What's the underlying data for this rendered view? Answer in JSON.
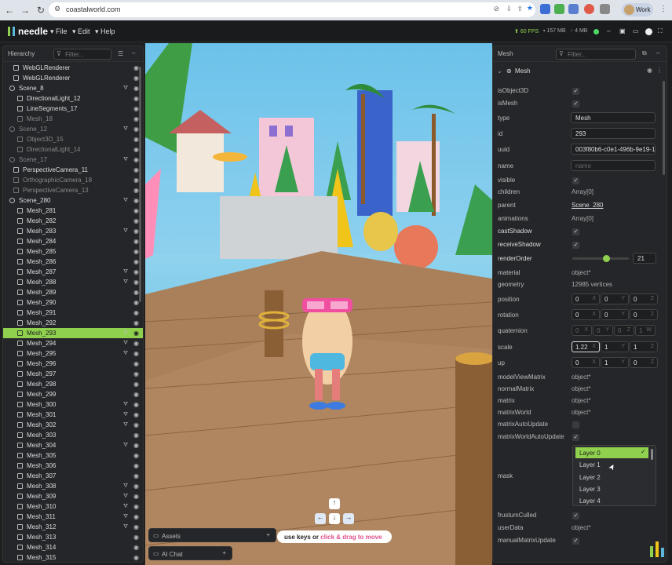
{
  "browser": {
    "url": "coastalworld.com",
    "profile": "Work"
  },
  "toolbar": {
    "logo": "needle",
    "menus": [
      "File",
      "Edit",
      "Help"
    ],
    "fps": "60 FPS",
    "memory": "157 MB",
    "gpu": "4 MB"
  },
  "hierarchy": {
    "title": "Hierarchy",
    "filter_placeholder": "Filter...",
    "items": [
      {
        "label": "WebGLRenderer",
        "dim": false,
        "indent": 1,
        "trigger": false
      },
      {
        "label": "WebGLRenderer",
        "dim": false,
        "indent": 1,
        "trigger": false
      },
      {
        "label": "Scene_8",
        "dim": false,
        "indent": 0,
        "trigger": true
      },
      {
        "label": "DirectionalLight_12",
        "dim": false,
        "indent": 2,
        "trigger": false
      },
      {
        "label": "LineSegments_17",
        "dim": false,
        "indent": 2,
        "trigger": false
      },
      {
        "label": "Mesh_18",
        "dim": true,
        "indent": 2,
        "trigger": false
      },
      {
        "label": "Scene_12",
        "dim": true,
        "indent": 0,
        "trigger": true
      },
      {
        "label": "Object3D_15",
        "dim": true,
        "indent": 2,
        "trigger": false
      },
      {
        "label": "DirectionalLight_14",
        "dim": true,
        "indent": 2,
        "trigger": false
      },
      {
        "label": "Scene_17",
        "dim": true,
        "indent": 0,
        "trigger": true
      },
      {
        "label": "PerspectiveCamera_11",
        "dim": false,
        "indent": 1,
        "trigger": false
      },
      {
        "label": "OrthographicCamera_18",
        "dim": true,
        "indent": 1,
        "trigger": false
      },
      {
        "label": "PerspectiveCamera_13",
        "dim": true,
        "indent": 1,
        "trigger": false
      },
      {
        "label": "Scene_280",
        "dim": false,
        "indent": 0,
        "trigger": true
      },
      {
        "label": "Mesh_281",
        "dim": false,
        "indent": 2,
        "trigger": false
      },
      {
        "label": "Mesh_282",
        "dim": false,
        "indent": 2,
        "trigger": false
      },
      {
        "label": "Mesh_283",
        "dim": false,
        "indent": 2,
        "trigger": true
      },
      {
        "label": "Mesh_284",
        "dim": false,
        "indent": 2,
        "trigger": false
      },
      {
        "label": "Mesh_285",
        "dim": false,
        "indent": 2,
        "trigger": false
      },
      {
        "label": "Mesh_286",
        "dim": false,
        "indent": 2,
        "trigger": false
      },
      {
        "label": "Mesh_287",
        "dim": false,
        "indent": 2,
        "trigger": true
      },
      {
        "label": "Mesh_288",
        "dim": false,
        "indent": 2,
        "trigger": true
      },
      {
        "label": "Mesh_289",
        "dim": false,
        "indent": 2,
        "trigger": false
      },
      {
        "label": "Mesh_290",
        "dim": false,
        "indent": 2,
        "trigger": false
      },
      {
        "label": "Mesh_291",
        "dim": false,
        "indent": 2,
        "trigger": false
      },
      {
        "label": "Mesh_292",
        "dim": false,
        "indent": 2,
        "trigger": false
      },
      {
        "label": "Mesh_293",
        "dim": false,
        "indent": 2,
        "trigger": true,
        "selected": true
      },
      {
        "label": "Mesh_294",
        "dim": false,
        "indent": 2,
        "trigger": true
      },
      {
        "label": "Mesh_295",
        "dim": false,
        "indent": 2,
        "trigger": true
      },
      {
        "label": "Mesh_296",
        "dim": false,
        "indent": 2,
        "trigger": false
      },
      {
        "label": "Mesh_297",
        "dim": false,
        "indent": 2,
        "trigger": false
      },
      {
        "label": "Mesh_298",
        "dim": false,
        "indent": 2,
        "trigger": false
      },
      {
        "label": "Mesh_299",
        "dim": false,
        "indent": 2,
        "trigger": false
      },
      {
        "label": "Mesh_300",
        "dim": false,
        "indent": 2,
        "trigger": true
      },
      {
        "label": "Mesh_301",
        "dim": false,
        "indent": 2,
        "trigger": true
      },
      {
        "label": "Mesh_302",
        "dim": false,
        "indent": 2,
        "trigger": true
      },
      {
        "label": "Mesh_303",
        "dim": false,
        "indent": 2,
        "trigger": false
      },
      {
        "label": "Mesh_304",
        "dim": false,
        "indent": 2,
        "trigger": true
      },
      {
        "label": "Mesh_305",
        "dim": false,
        "indent": 2,
        "trigger": false
      },
      {
        "label": "Mesh_306",
        "dim": false,
        "indent": 2,
        "trigger": false
      },
      {
        "label": "Mesh_307",
        "dim": false,
        "indent": 2,
        "trigger": false
      },
      {
        "label": "Mesh_308",
        "dim": false,
        "indent": 2,
        "trigger": true
      },
      {
        "label": "Mesh_309",
        "dim": false,
        "indent": 2,
        "trigger": true
      },
      {
        "label": "Mesh_310",
        "dim": false,
        "indent": 2,
        "trigger": true
      },
      {
        "label": "Mesh_311",
        "dim": false,
        "indent": 2,
        "trigger": true
      },
      {
        "label": "Mesh_312",
        "dim": false,
        "indent": 2,
        "trigger": true
      },
      {
        "label": "Mesh_313",
        "dim": false,
        "indent": 2,
        "trigger": false
      },
      {
        "label": "Mesh_314",
        "dim": false,
        "indent": 2,
        "trigger": false
      },
      {
        "label": "Mesh_315",
        "dim": false,
        "indent": 2,
        "trigger": false
      }
    ]
  },
  "viewport": {
    "hint_prefix": "use keys or",
    "hint_accent": "click & drag to move"
  },
  "bottom_panels": {
    "assets": "Assets",
    "ai_chat": "AI Chat"
  },
  "inspector": {
    "title": "Mesh",
    "filter_placeholder": "Filter...",
    "section": "Mesh",
    "props": {
      "isObject3D": "isObject3D",
      "isMesh": "isMesh",
      "type": "type",
      "type_val": "Mesh",
      "id": "id",
      "id_val": "293",
      "uuid": "uuid",
      "uuid_val": "003f80b6-c0e1-496b-9e19-1f",
      "name": "name",
      "name_placeholder": "name",
      "visible": "visible",
      "children": "children",
      "children_val": "Array[0]",
      "parent": "parent",
      "parent_val": "Scene_280",
      "animations": "animations",
      "animations_val": "Array[0]",
      "castShadow": "castShadow",
      "receiveShadow": "receiveShadow",
      "renderOrder": "renderOrder",
      "renderOrder_val": "21",
      "material": "material",
      "material_val": "object*",
      "geometry": "geometry",
      "geometry_val": "12985 vertices",
      "position": "position",
      "rotation": "rotation",
      "quaternion": "quaternion",
      "scale": "scale",
      "up": "up",
      "modelViewMatrix": "modelViewMatrix",
      "normalMatrix": "normalMatrix",
      "matrix": "matrix",
      "matrixWorld": "matrixWorld",
      "obj_val": "object*",
      "matrixAutoUpdate": "matrixAutoUpdate",
      "matrixWorldAutoUpdate": "matrixWorldAutoUpdate",
      "mask": "mask",
      "frustumCulled": "frustumCulled",
      "userData": "userData",
      "manualMatrixUpdate": "manualMatrixUpdate"
    },
    "vectors": {
      "position": [
        "0",
        "0",
        "0"
      ],
      "rotation": [
        "0",
        "0",
        "0"
      ],
      "quaternion": [
        "0",
        "0",
        "0",
        "1"
      ],
      "scale": [
        "1.22",
        "1",
        "1"
      ],
      "up": [
        "0",
        "1",
        "0"
      ]
    },
    "axes": [
      "X",
      "Y",
      "Z",
      "W"
    ],
    "layers": [
      "Layer 0",
      "Layer 1",
      "Layer 2",
      "Layer 3",
      "Layer 4"
    ],
    "layer_selected": "Layer 0",
    "renderOrder_slider": 0.6
  },
  "colors": {
    "accent": "#8fd14f",
    "selection": "#8fd14f",
    "panel": "#252629"
  }
}
